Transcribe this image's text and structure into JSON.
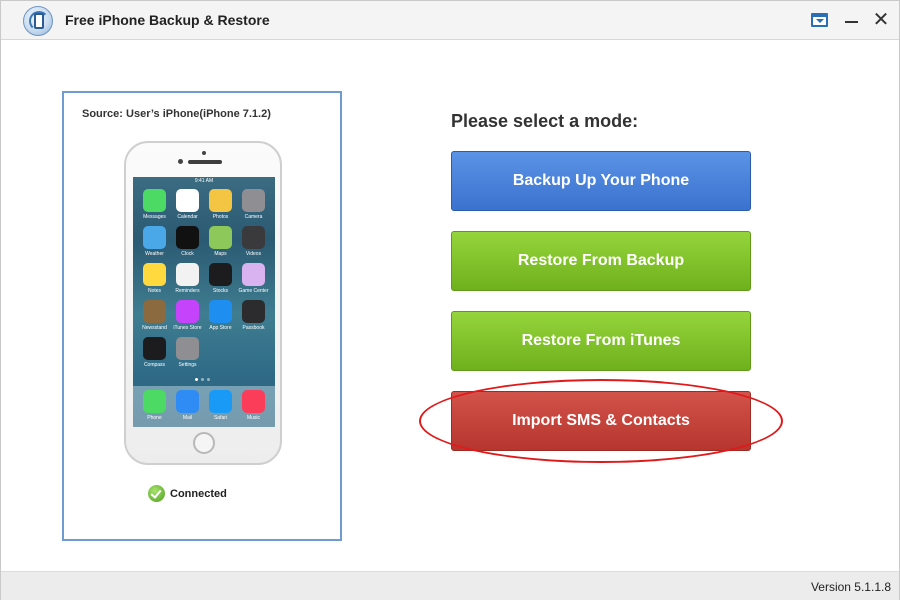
{
  "window": {
    "title": "Free iPhone Backup & Restore",
    "close_glyph": "✕"
  },
  "source": {
    "label": "Source: User’s iPhone(iPhone 7.1.2)",
    "status": "Connected",
    "phone_time": "9:41 AM"
  },
  "apps": [
    {
      "name": "Messages",
      "color": "#4cd964"
    },
    {
      "name": "Calendar",
      "color": "#ffffff"
    },
    {
      "name": "Photos",
      "color": "#f4c542"
    },
    {
      "name": "Camera",
      "color": "#8e8e93"
    },
    {
      "name": "Weather",
      "color": "#4aa8e8"
    },
    {
      "name": "Clock",
      "color": "#111111"
    },
    {
      "name": "Maps",
      "color": "#8cc85a"
    },
    {
      "name": "Videos",
      "color": "#3a3a3c"
    },
    {
      "name": "Notes",
      "color": "#ffd93d"
    },
    {
      "name": "Reminders",
      "color": "#f2f2f2"
    },
    {
      "name": "Stocks",
      "color": "#1c1c1e"
    },
    {
      "name": "Game Center",
      "color": "#d9b3f0"
    },
    {
      "name": "Newsstand",
      "color": "#8b6a3f"
    },
    {
      "name": "iTunes Store",
      "color": "#c643fc"
    },
    {
      "name": "App Store",
      "color": "#1f8ef1"
    },
    {
      "name": "Passbook",
      "color": "#2c2c2e"
    },
    {
      "name": "Compass",
      "color": "#1c1c1e"
    },
    {
      "name": "Settings",
      "color": "#8e8e93"
    }
  ],
  "dock": [
    {
      "name": "Phone",
      "color": "#4cd964"
    },
    {
      "name": "Mail",
      "color": "#2f8cf5"
    },
    {
      "name": "Safari",
      "color": "#1a9af7"
    },
    {
      "name": "Music",
      "color": "#fc3d5a"
    }
  ],
  "mode": {
    "title": "Please select a mode:",
    "buttons": {
      "backup": "Backup Up Your Phone",
      "restore_backup": "Restore From Backup",
      "restore_itunes": "Restore From iTunes",
      "import": "Import SMS & Contacts"
    }
  },
  "footer": {
    "version": "Version 5.1.1.8"
  },
  "colors": {
    "backup_button": "#3a72cf",
    "restore_button": "#6fb11d",
    "import_button": "#b7352e",
    "highlight_ellipse": "#e0191b",
    "panel_border": "#6e9bd2"
  }
}
